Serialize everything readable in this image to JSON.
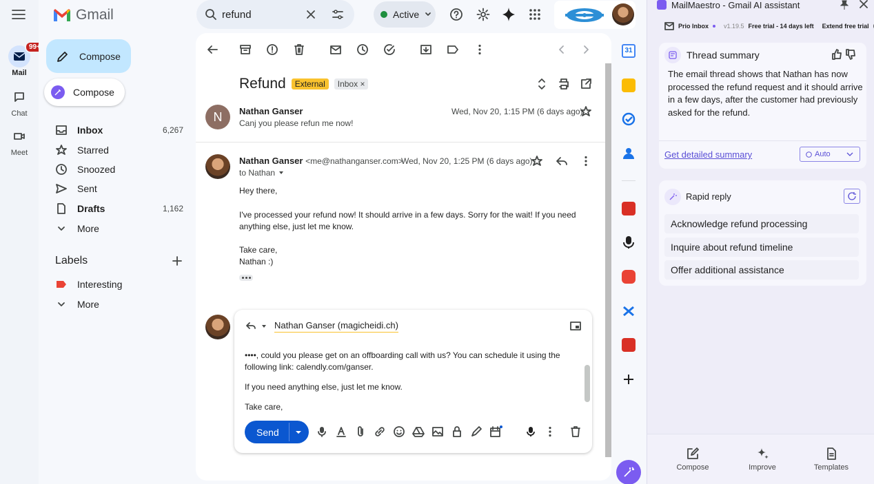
{
  "rail": {
    "mail_label": "Mail",
    "mail_badge": "99+",
    "chat_label": "Chat",
    "meet_label": "Meet"
  },
  "gmail": {
    "logo_text": "Gmail",
    "compose_label": "Compose",
    "mm_compose_label": "Compose",
    "nav": [
      {
        "label": "Inbox",
        "count": "6,267"
      },
      {
        "label": "Starred",
        "count": ""
      },
      {
        "label": "Snoozed",
        "count": ""
      },
      {
        "label": "Sent",
        "count": ""
      },
      {
        "label": "Drafts",
        "count": "1,162"
      },
      {
        "label": "More",
        "count": ""
      }
    ],
    "labels_heading": "Labels",
    "labels": [
      {
        "label": "Interesting",
        "color": "#ea4335"
      },
      {
        "label": "More"
      }
    ]
  },
  "search": {
    "value": "refund"
  },
  "status": {
    "label": "Active",
    "color": "#1e8e3e"
  },
  "thread": {
    "subject": "Refund",
    "badge_external": "External",
    "badge_inbox": "Inbox",
    "msg1": {
      "avatar_letter": "N",
      "sender": "Nathan Ganser",
      "date": "Wed, Nov 20, 1:15 PM (6 days ago)",
      "snippet": "Canj you please refun me now!"
    },
    "msg2": {
      "sender": "Nathan Ganser",
      "email": "<me@nathanganser.com>",
      "date": "Wed, Nov 20, 1:25 PM (6 days ago)",
      "to": "to Nathan",
      "body": [
        "Hey there,",
        "I've processed your refund now! It should arrive in a few days. Sorry for the wait! If you need",
        "anything else, just let me know.",
        "Take care,",
        "Nathan :)"
      ]
    },
    "reply": {
      "to": "Nathan Ganser (magicheidi.ch)",
      "line1": "••••, could you please get on an offboarding call with us? You can schedule it using the",
      "line2": "following link: calendly.com/ganser.",
      "line3": "If you need anything else, just let me know.",
      "line4": "Take care,",
      "send_label": "Send"
    }
  },
  "maestro": {
    "title": "MailMaestro - Gmail AI assistant",
    "prio": "Prio Inbox",
    "version": "v1.19.5",
    "trial": "Free trial - 14 days left",
    "extend": "Extend free trial",
    "summary_title": "Thread summary",
    "summary_text": "The email thread shows that Nathan has now processed the refund request and it should arrive in a few days, after the customer had previously asked for the refund.",
    "detailed_link": "Get detailed summary",
    "auto_select": "Auto",
    "rapid_title": "Rapid reply",
    "options": [
      "Acknowledge refund processing",
      "Inquire about refund timeline",
      "Offer additional assistance"
    ],
    "bottom": [
      {
        "label": "Compose"
      },
      {
        "label": "Improve"
      },
      {
        "label": "Templates"
      }
    ]
  }
}
